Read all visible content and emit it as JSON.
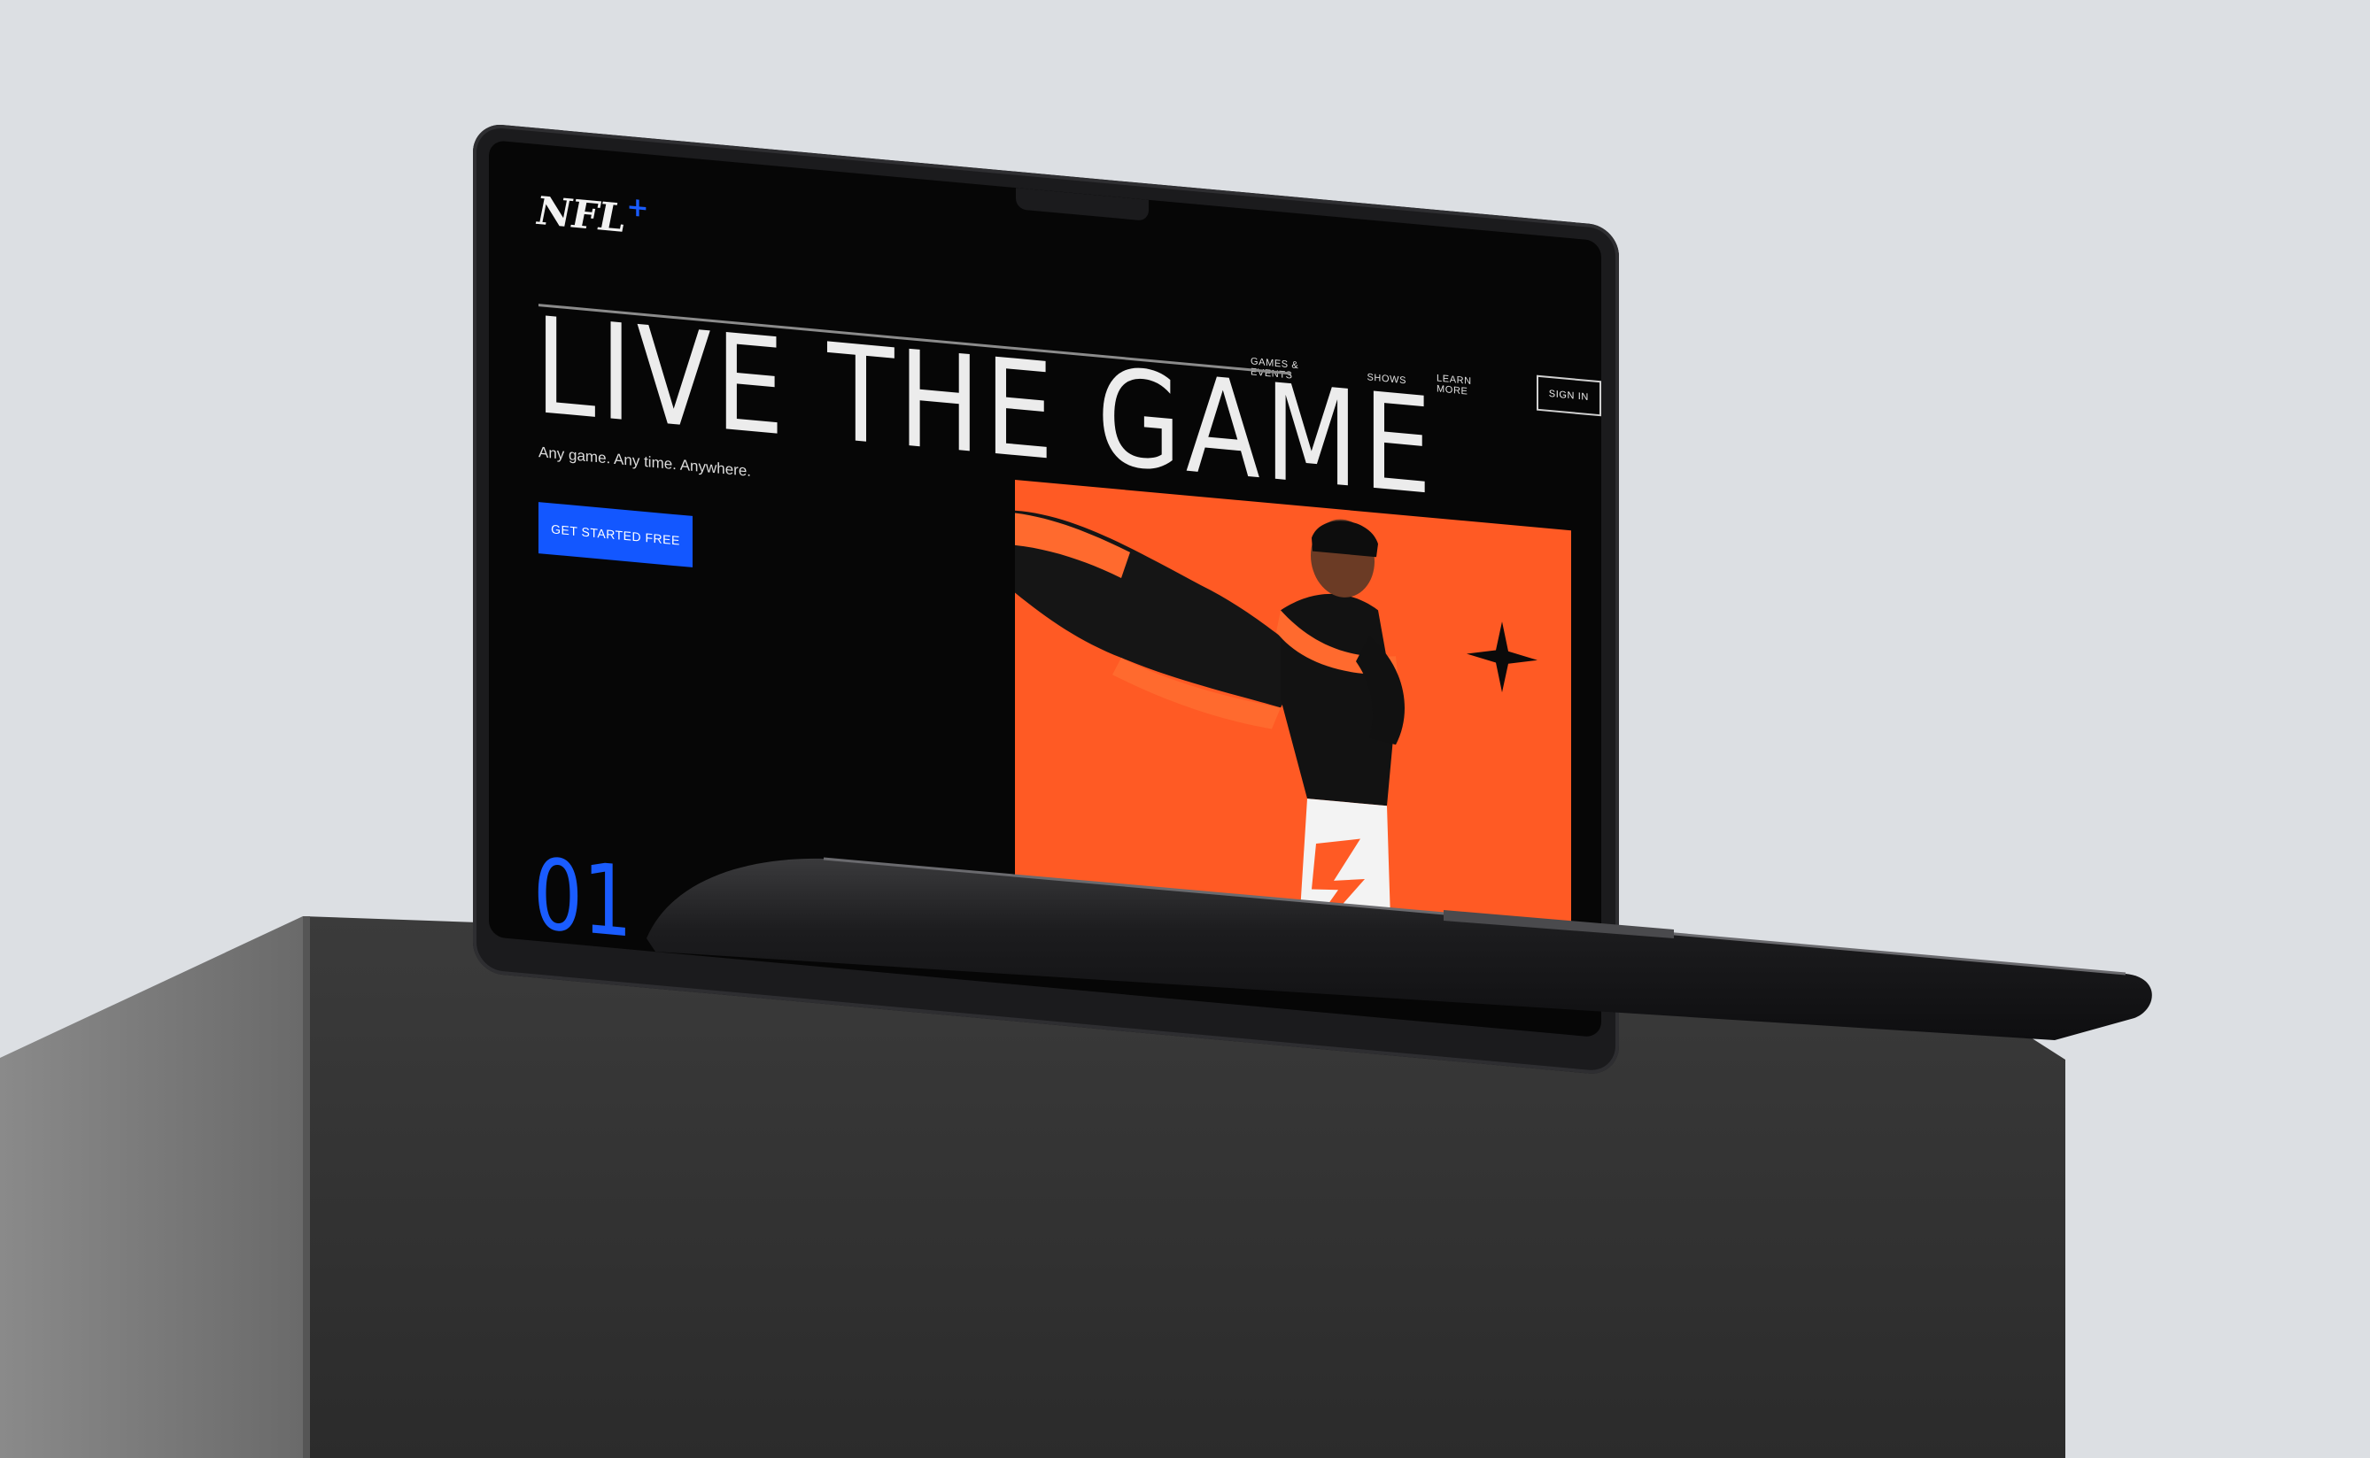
{
  "site": {
    "logo_text": "NFL",
    "logo_plus": "+"
  },
  "nav": {
    "items": [
      {
        "label": "GAMES & EVENTS"
      },
      {
        "label": "SHOWS"
      },
      {
        "label": "LEARN MORE"
      }
    ],
    "signin_label": "SIGN IN"
  },
  "hero": {
    "title": "LIVE THE GAME",
    "tagline": "Any game. Any time. Anywhere.",
    "cta_label": "GET STARTED FREE",
    "section_number": "01"
  },
  "colors": {
    "accent_blue": "#1357ff",
    "feature_orange": "#ff5a24",
    "screen_bg": "#060606"
  },
  "icons": [
    "nfl-plus-logo-icon",
    "plus-star-icon"
  ]
}
